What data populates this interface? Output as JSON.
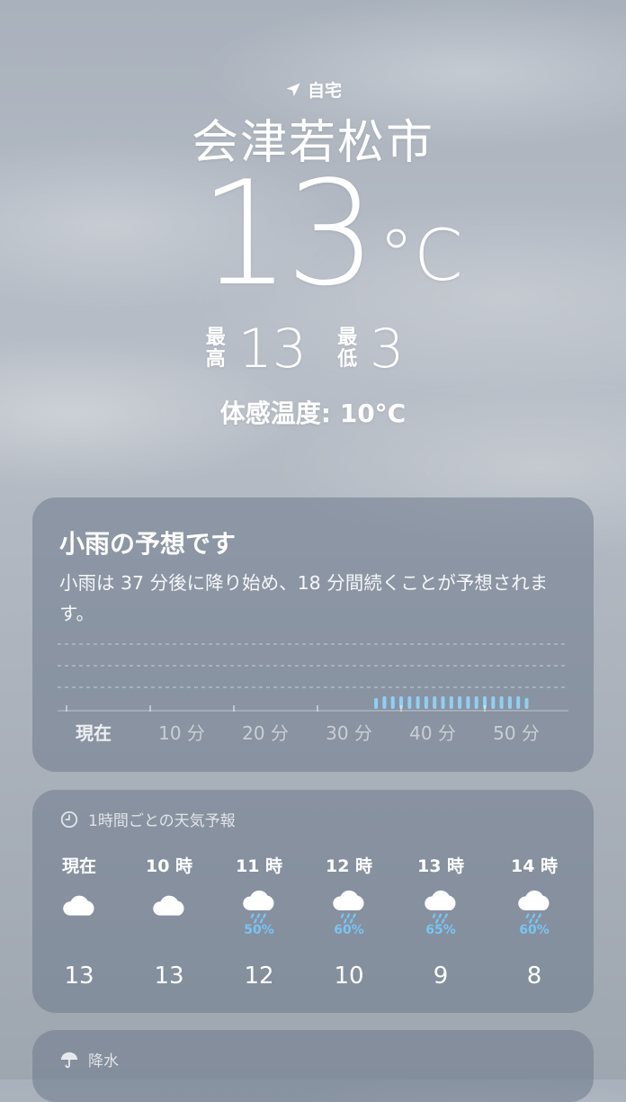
{
  "location": {
    "label": "自宅",
    "icon": "location-arrow-icon"
  },
  "city": "会津若松市",
  "current": {
    "temp": "13",
    "unit": "°C"
  },
  "high": {
    "label_1": "最",
    "label_2": "高",
    "value": "13"
  },
  "low": {
    "label_1": "最",
    "label_2": "低",
    "value": "3"
  },
  "feels_like": "体感温度: 10°C",
  "precip_card": {
    "title": "小雨の予想です",
    "description": "小雨は 37 分後に降り始め、18 分間続くことが予想されます。",
    "ticks": [
      "現在",
      "10 分",
      "20 分",
      "30 分",
      "40 分",
      "50 分"
    ],
    "chart_data": {
      "type": "bar",
      "x_unit": "分",
      "rain_start_min": 37,
      "rain_duration_min": 18,
      "intensity": "light",
      "accent_color": "#8fd0f5"
    }
  },
  "hourly_card": {
    "header": "1時間ごとの天気予報",
    "header_icon": "clock-icon",
    "hours": [
      {
        "time": "現在",
        "icon": "cloud-icon",
        "pct": "",
        "temp": "13"
      },
      {
        "time": "10 時",
        "icon": "cloud-icon",
        "pct": "",
        "temp": "13"
      },
      {
        "time": "11 時",
        "icon": "cloud-rain-icon",
        "pct": "50%",
        "temp": "12"
      },
      {
        "time": "12 時",
        "icon": "cloud-rain-icon",
        "pct": "60%",
        "temp": "10"
      },
      {
        "time": "13 時",
        "icon": "cloud-rain-icon",
        "pct": "65%",
        "temp": "9"
      },
      {
        "time": "14 時",
        "icon": "cloud-rain-icon",
        "pct": "60%",
        "temp": "8"
      }
    ]
  },
  "precip_section": {
    "header": "降水",
    "header_icon": "umbrella-icon"
  },
  "colors": {
    "card_bg": "#6e7a8c",
    "rain_pct": "#78c5f2"
  }
}
